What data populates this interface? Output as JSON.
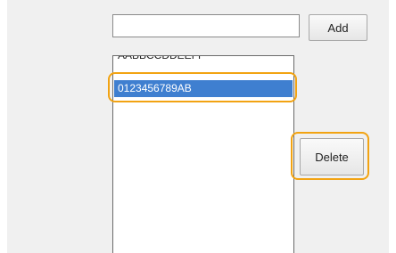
{
  "form": {
    "input_value": "",
    "add_label": "Add",
    "delete_label": "Delete"
  },
  "list": {
    "items": [
      {
        "label": "AABBCCDDEEFF",
        "selected": false
      },
      {
        "label": "0123456789AB",
        "selected": true
      }
    ]
  },
  "colors": {
    "highlight": "#f2a312",
    "selection": "#3f7fd0",
    "panel_background": "#f0f0f0"
  }
}
